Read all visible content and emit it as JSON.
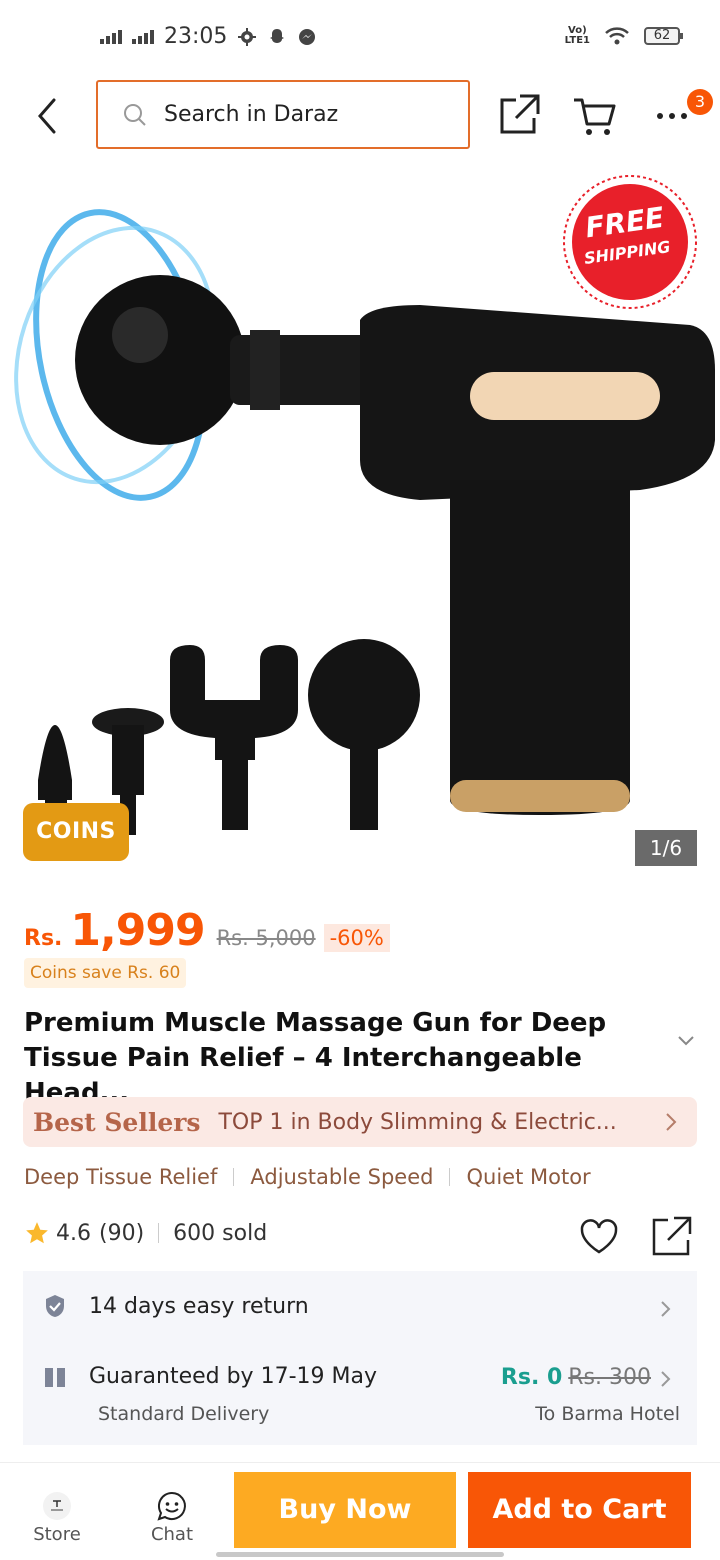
{
  "status_bar": {
    "time": "23:05",
    "battery": "62",
    "network": "LTE1"
  },
  "header": {
    "search_placeholder": "Search in Daraz",
    "cart_badge": "3"
  },
  "hero": {
    "coins_tag": "COINS",
    "pager": "1/6",
    "free_shipping_line1": "FREE",
    "free_shipping_line2": "SHIPPING"
  },
  "price": {
    "currency": "Rs.",
    "current": "1,999",
    "original": "Rs. 5,000",
    "discount": "-60%",
    "coins_save": "Coins save Rs. 60"
  },
  "product": {
    "title": "Premium Muscle Massage Gun for Deep Tissue Pain Relief – 4 Interchangeable Head..."
  },
  "best_sellers": {
    "logo": "Best Sellers",
    "text": "TOP 1 in Body Slimming & Electric..."
  },
  "features": [
    "Deep Tissue Relief",
    "Adjustable Speed",
    "Quiet Motor"
  ],
  "rating": {
    "score": "4.6",
    "count": "(90)",
    "sold": "600 sold",
    "star_fraction": 0.92
  },
  "service": {
    "return_text": "14 days easy return",
    "delivery_text": "Guaranteed by 17-19 May",
    "delivery_sub": "Standard Delivery",
    "fee_new": "Rs. 0",
    "fee_old": "Rs. 300",
    "destination": "To Barma Hotel"
  },
  "bottom_bar": {
    "store_label": "Store",
    "chat_label": "Chat",
    "buy_now": "Buy Now",
    "add_to_cart": "Add to Cart"
  },
  "colors": {
    "accent": "#f85606",
    "buy_now": "#fdaa22",
    "search_border": "#e36d2a",
    "coins": "#e39a14",
    "free_shipping": "#e8202a",
    "fee_green": "#1a9e8f"
  }
}
